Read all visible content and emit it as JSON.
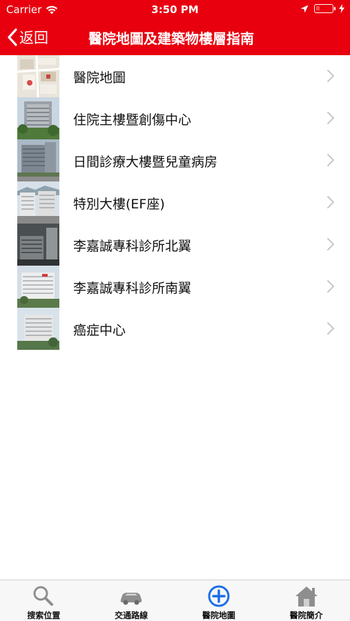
{
  "status_bar": {
    "carrier": "Carrier",
    "time": "3:50 PM"
  },
  "nav": {
    "back_label": "返回",
    "title": "醫院地圖及建築物樓層指南"
  },
  "list": [
    {
      "label": "醫院地圖",
      "thumb": "map-thumbnail"
    },
    {
      "label": "住院主樓暨創傷中心",
      "thumb": "building-thumbnail"
    },
    {
      "label": "日間診療大樓暨兒童病房",
      "thumb": "building-thumbnail"
    },
    {
      "label": "特別大樓(EF座)",
      "thumb": "building-thumbnail"
    },
    {
      "label": "李嘉誠專科診所北翼",
      "thumb": "building-thumbnail"
    },
    {
      "label": "李嘉誠專科診所南翼",
      "thumb": "building-thumbnail"
    },
    {
      "label": "癌症中心",
      "thumb": "building-thumbnail"
    }
  ],
  "tabs": [
    {
      "label": "搜索位置",
      "icon": "search-icon"
    },
    {
      "label": "交通路線",
      "icon": "car-icon"
    },
    {
      "label": "醫院地圖",
      "icon": "plus-circle-icon"
    },
    {
      "label": "醫院簡介",
      "icon": "home-icon"
    }
  ],
  "colors": {
    "header": "#e8000f",
    "tab_active": "#1a6ee8",
    "tab_inactive": "#8e8e8e"
  }
}
